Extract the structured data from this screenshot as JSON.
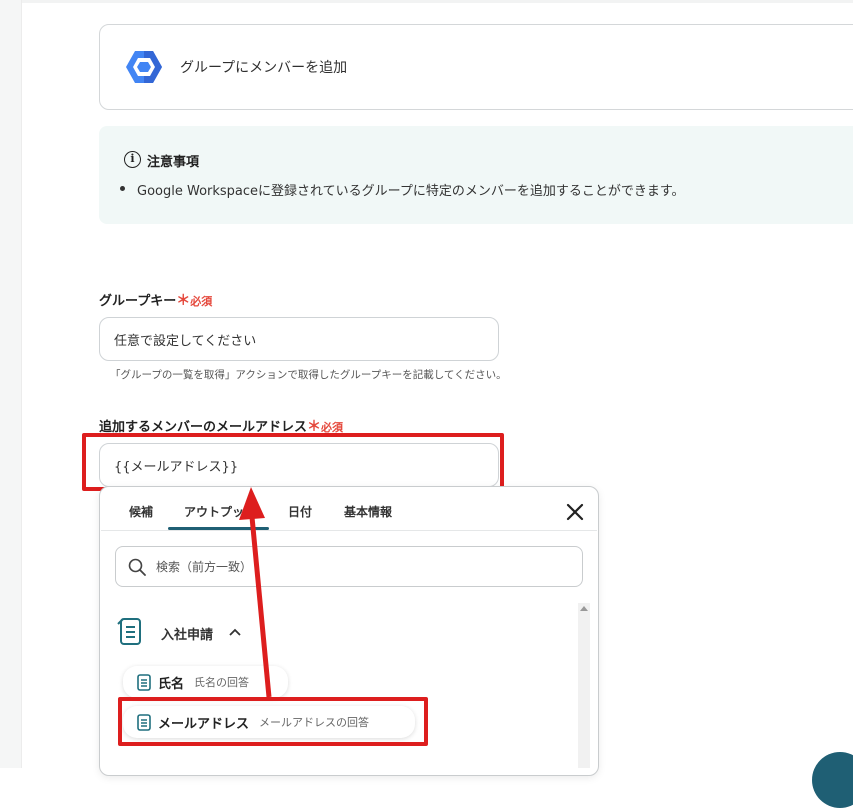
{
  "app": {
    "name": "グループにメンバーを追加"
  },
  "notice": {
    "title": "注意事項",
    "items": [
      "Google Workspaceに登録されているグループに特定のメンバーを追加することができます。"
    ]
  },
  "fields": {
    "group_key": {
      "label": "グループキー",
      "required_mark": "＊",
      "required_text": "必須",
      "placeholder": "任意で設定してください",
      "hint": "「グループの一覧を取得」アクションで取得したグループキーを記載してください。"
    },
    "member_email": {
      "label": "追加するメンバーのメールアドレス",
      "required_mark": "＊",
      "required_text": "必須",
      "value": "{{メールアドレス}}"
    }
  },
  "popup": {
    "tabs": [
      "候補",
      "アウトプット",
      "日付",
      "基本情報"
    ],
    "active_tab": "アウトプット",
    "search_placeholder": "検索（前方一致）",
    "group": {
      "label": "入社申請",
      "expanded": true
    },
    "items": [
      {
        "title": "氏名",
        "sub": "氏名の回答"
      },
      {
        "title": "メールアドレス",
        "sub": "メールアドレスの回答"
      }
    ]
  },
  "colors": {
    "accent": "#1f5f74",
    "required": "#e5483c",
    "highlight": "#dd1e1e",
    "notice_bg": "#f1f8f7"
  },
  "icons": [
    "google-workspace-logo-icon",
    "info-icon",
    "close-icon",
    "search-icon",
    "form-icon",
    "chevron-up-icon",
    "arrow-annotation"
  ]
}
